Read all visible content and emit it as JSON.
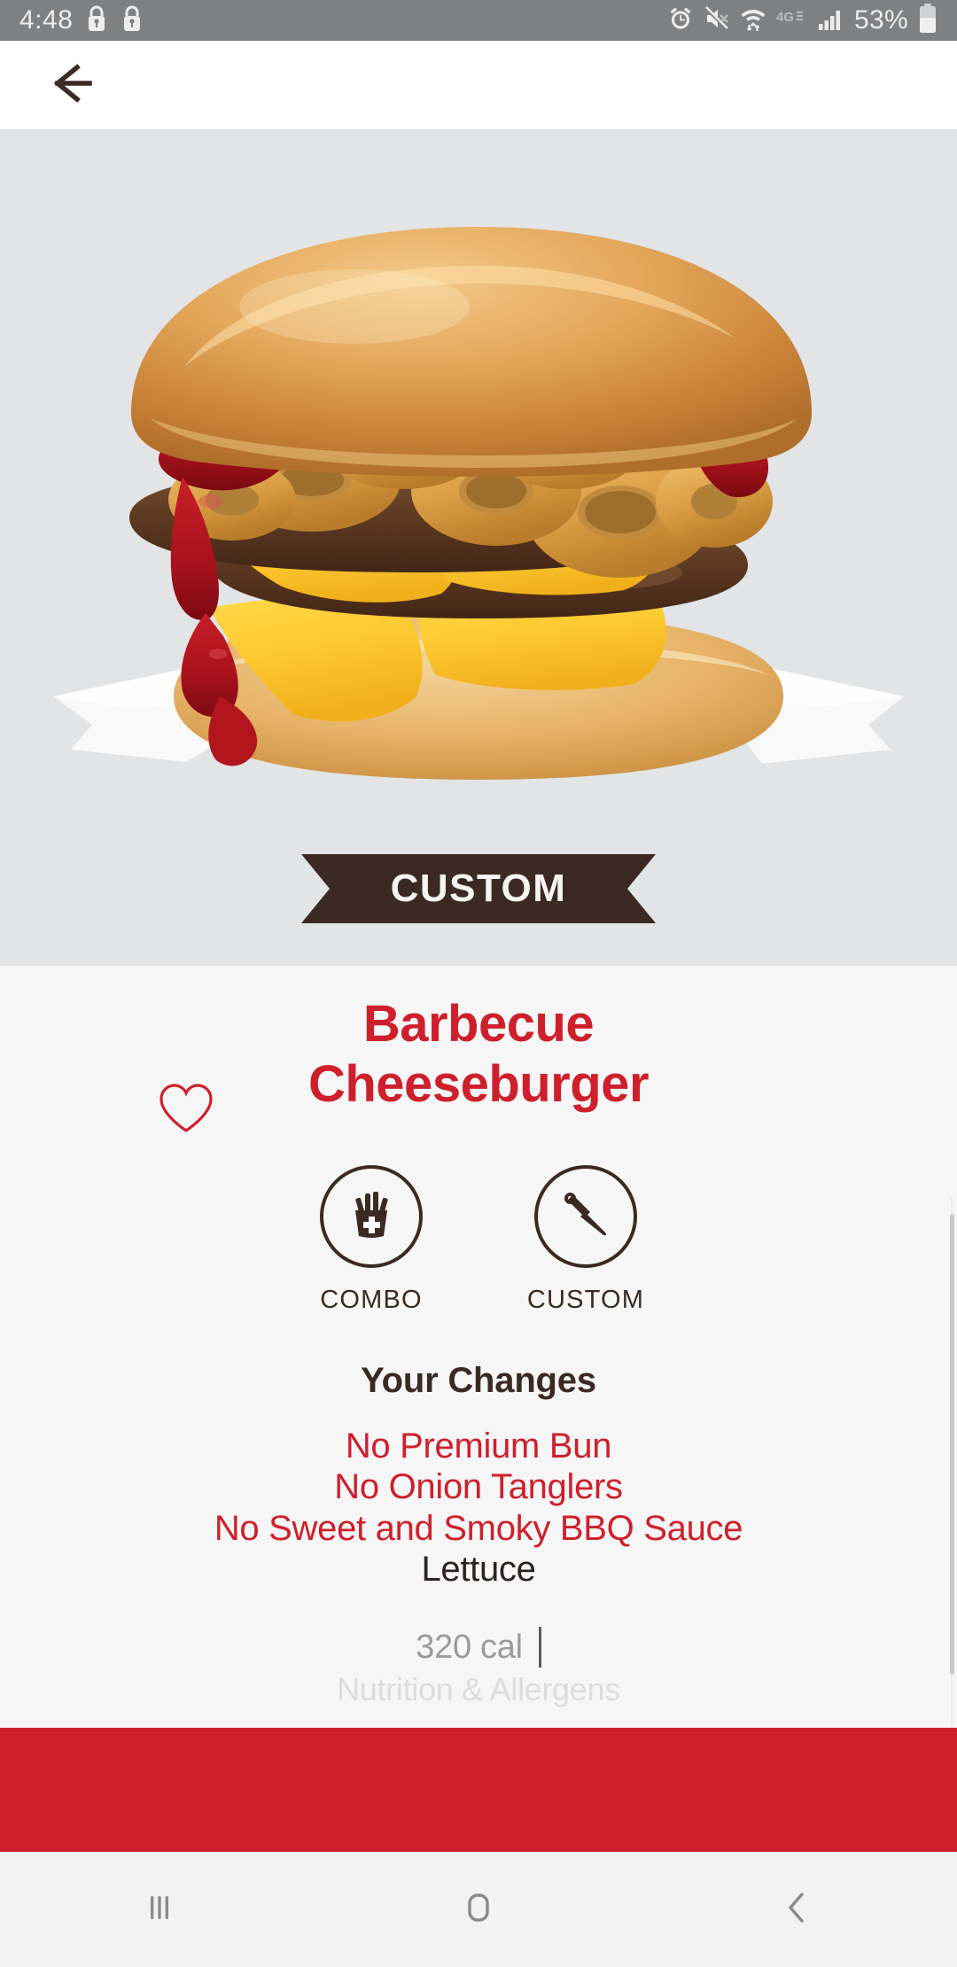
{
  "statusbar": {
    "time": "4:48",
    "battery_pct": "53%",
    "icons": [
      "lock-icon",
      "lock-icon",
      "alarm-icon",
      "mute-icon",
      "wifi-icon",
      "network-4g-icon",
      "signal-bars-icon",
      "battery-icon"
    ],
    "network_label": "4G"
  },
  "appbar": {
    "back_icon": "back-arrow-icon"
  },
  "hero": {
    "image_alt": "barbecue-cheeseburger-photo",
    "ribbon_label": "CUSTOM",
    "background_color": "#E2E4E6",
    "ribbon_color": "#3B2A24"
  },
  "product": {
    "title": "Barbecue\nCheeseburger",
    "title_line1": "Barbecue",
    "title_line2": "Cheeseburger",
    "title_color": "#CE202C",
    "favorite_icon": "heart-outline-icon",
    "favorited": false
  },
  "actions": [
    {
      "label": "COMBO",
      "icon": "fries-plus-icon"
    },
    {
      "label": "CUSTOM",
      "icon": "knife-icon"
    }
  ],
  "changes": {
    "heading": "Your Changes",
    "items": [
      {
        "text": "No Premium Bun",
        "type": "removed"
      },
      {
        "text": "No Onion Tanglers",
        "type": "removed"
      },
      {
        "text": "No Sweet and Smoky BBQ Sauce",
        "type": "removed"
      },
      {
        "text": "Lettuce",
        "type": "added"
      }
    ]
  },
  "nutrition": {
    "calories": "320 cal",
    "link_label": "Nutrition & Allergens"
  },
  "cta": {
    "color": "#CE202C",
    "label": ""
  },
  "navbar": {
    "recents_icon": "recent-apps-icon",
    "home_icon": "home-icon",
    "back_icon": "nav-back-icon"
  }
}
